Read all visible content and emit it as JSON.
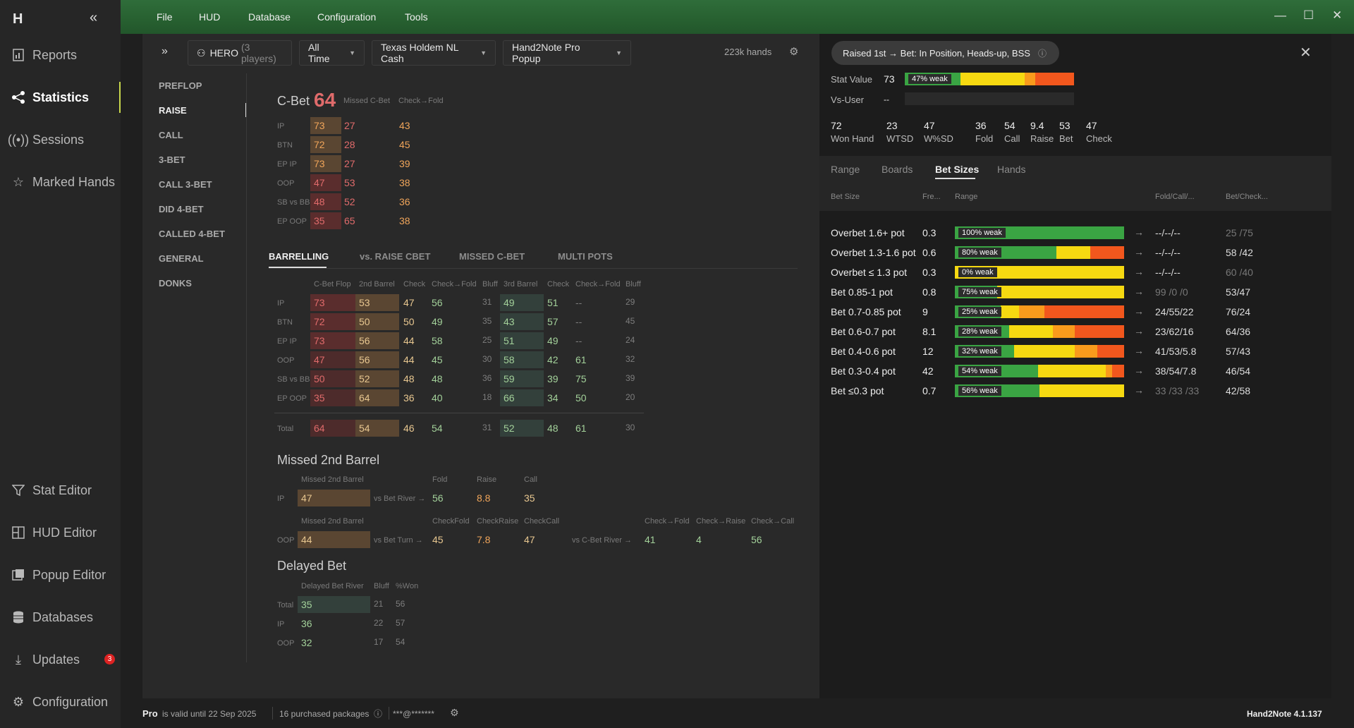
{
  "app": {
    "logo": "H",
    "version": "Hand2Note 4.1.137"
  },
  "nav": {
    "items": [
      {
        "label": "Reports",
        "icon": "report-icon"
      },
      {
        "label": "Statistics",
        "icon": "share-nodes-icon",
        "active": true
      },
      {
        "label": "Sessions",
        "icon": "broadcast-icon"
      },
      {
        "label": "Marked Hands",
        "icon": "star-icon"
      }
    ],
    "bottom": [
      {
        "label": "Stat Editor",
        "icon": "filter-icon"
      },
      {
        "label": "HUD Editor",
        "icon": "grid-icon"
      },
      {
        "label": "Popup Editor",
        "icon": "popup-icon"
      },
      {
        "label": "Databases",
        "icon": "database-icon"
      },
      {
        "label": "Updates",
        "icon": "download-icon",
        "badge": "3"
      },
      {
        "label": "Configuration",
        "icon": "gear-icon"
      }
    ]
  },
  "menu": [
    "File",
    "HUD",
    "Database",
    "Configuration",
    "Tools"
  ],
  "toolbar": {
    "player": "HERO",
    "player_sub": "(3 players)",
    "time": "All Time",
    "game": "Texas Holdem NL Cash",
    "popup": "Hand2Note Pro Popup",
    "hands": "223k hands"
  },
  "categories": [
    "PREFLOP",
    "RAISE",
    "CALL",
    "3-BET",
    "CALL 3-BET",
    "DID 4-BET",
    "CALLED 4-BET",
    "GENERAL",
    "DONKS"
  ],
  "cbet": {
    "title": "C-Bet",
    "value": "64",
    "h_missed": "Missed C-Bet",
    "h_checkfold": "Check→Fold",
    "rows": [
      {
        "pos": "IP",
        "v": "73",
        "m": "27",
        "cf": "43"
      },
      {
        "pos": "BTN",
        "v": "72",
        "m": "28",
        "cf": "45"
      },
      {
        "pos": "EP IP",
        "v": "73",
        "m": "27",
        "cf": "39"
      },
      {
        "pos": "OOP",
        "v": "47",
        "m": "53",
        "cf": "38"
      },
      {
        "pos": "SB vs BB",
        "v": "48",
        "m": "52",
        "cf": "36"
      },
      {
        "pos": "EP OOP",
        "v": "35",
        "m": "65",
        "cf": "38"
      }
    ]
  },
  "tabs": [
    "BARRELLING",
    "vs. RAISE CBET",
    "MISSED C-BET",
    "MULTI POTS"
  ],
  "barrel": {
    "headers": [
      "C-Bet Flop",
      "2nd Barrel",
      "Check",
      "Check→Fold",
      "Bluff",
      "3rd Barrel",
      "Check",
      "Check→Fold",
      "Bluff"
    ],
    "rows": [
      {
        "pos": "IP",
        "c": [
          "73",
          "53",
          "47",
          "56",
          "31",
          "49",
          "51",
          "--",
          "29"
        ]
      },
      {
        "pos": "BTN",
        "c": [
          "72",
          "50",
          "50",
          "49",
          "35",
          "43",
          "57",
          "--",
          "45"
        ]
      },
      {
        "pos": "EP IP",
        "c": [
          "73",
          "56",
          "44",
          "58",
          "25",
          "51",
          "49",
          "--",
          "24"
        ]
      },
      {
        "pos": "OOP",
        "c": [
          "47",
          "56",
          "44",
          "45",
          "30",
          "58",
          "42",
          "61",
          "32"
        ]
      },
      {
        "pos": "SB vs BB",
        "c": [
          "50",
          "52",
          "48",
          "48",
          "36",
          "59",
          "39",
          "75",
          "39"
        ]
      },
      {
        "pos": "EP OOP",
        "c": [
          "35",
          "64",
          "36",
          "40",
          "18",
          "66",
          "34",
          "50",
          "20"
        ]
      }
    ],
    "total": {
      "pos": "Total",
      "c": [
        "64",
        "54",
        "46",
        "54",
        "31",
        "52",
        "48",
        "61",
        "30"
      ]
    }
  },
  "missed2": {
    "title": "Missed 2nd Barrel",
    "r1": {
      "h": "Missed 2nd Barrel",
      "pos": "IP",
      "v": "47",
      "vs": "vs Bet River →",
      "hFold": "Fold",
      "hRaise": "Raise",
      "hCall": "Call",
      "fold": "56",
      "raise": "8.8",
      "call": "35"
    },
    "r2": {
      "h": "Missed 2nd Barrel",
      "pos": "OOP",
      "v": "44",
      "vs": "vs Bet Turn →",
      "hCF": "CheckFold",
      "hCR": "CheckRaise",
      "hCC": "CheckCall",
      "cf": "45",
      "cr": "7.8",
      "cc": "47",
      "vs2": "vs C-Bet River →",
      "h2cf": "Check→Fold",
      "h2cr": "Check→Raise",
      "h2cc": "Check→Call",
      "v2cf": "41",
      "v2cr": "4",
      "v2cc": "56"
    }
  },
  "delayed": {
    "title": "Delayed Bet",
    "h": [
      "Delayed Bet River",
      "Bluff",
      "%Won"
    ],
    "rows": [
      {
        "pos": "Total",
        "v": "35",
        "b": "21",
        "w": "56"
      },
      {
        "pos": "IP",
        "v": "36",
        "b": "22",
        "w": "57"
      },
      {
        "pos": "OOP",
        "v": "32",
        "b": "17",
        "w": "54"
      }
    ]
  },
  "right": {
    "pill": "Raised 1st → Bet: In Position, Heads-up, BSS",
    "stat_value_label": "Stat Value",
    "stat_value": "73",
    "stat_weak": "47% weak",
    "vs_user_label": "Vs-User",
    "vs_user": "--",
    "stats": [
      {
        "v": "72",
        "l": "Won Hand"
      },
      {
        "v": "23",
        "l": "WTSD"
      },
      {
        "v": "47",
        "l": "W%SD"
      },
      {
        "v": "36",
        "l": "Fold"
      },
      {
        "v": "54",
        "l": "Call"
      },
      {
        "v": "9.4",
        "l": "Raise"
      },
      {
        "v": "53",
        "l": "Bet"
      },
      {
        "v": "47",
        "l": "Check"
      }
    ],
    "tabs": [
      "Range",
      "Boards",
      "Bet Sizes",
      "Hands"
    ],
    "cols": [
      "Bet Size",
      "Fre...",
      "Range",
      "Fold/Call/...",
      "Bet/Check..."
    ],
    "rows": [
      {
        "label": "Overbet 1.6+ pot",
        "freq": "0.3",
        "weak": "100% weak",
        "fcr": "--/--/--",
        "bc": "25 /75",
        "bc_dim": true,
        "bar": [
          100,
          0,
          0,
          0
        ]
      },
      {
        "label": "Overbet 1.3-1.6 pot",
        "freq": "0.6",
        "weak": "80% weak",
        "fcr": "--/--/--",
        "bc": "58 /42",
        "bar": [
          60,
          20,
          0,
          20
        ]
      },
      {
        "label": "Overbet ≤ 1.3 pot",
        "freq": "0.3",
        "weak": "0% weak",
        "fcr": "--/--/--",
        "bc": "60 /40",
        "bc_dim": true,
        "bar": [
          0,
          100,
          0,
          0
        ]
      },
      {
        "label": "Bet 0.85-1 pot",
        "freq": "0.8",
        "weak": "75% weak",
        "fcr": "99 /0 /0",
        "fcr_dim": true,
        "bc": "53/47",
        "bar": [
          25,
          75,
          0,
          0
        ]
      },
      {
        "label": "Bet 0.7-0.85 pot",
        "freq": "9",
        "weak": "25% weak",
        "fcr": "24/55/22",
        "bc": "76/24",
        "bar": [
          27,
          11,
          15,
          47
        ]
      },
      {
        "label": "Bet 0.6-0.7 pot",
        "freq": "8.1",
        "weak": "28% weak",
        "fcr": "23/62/16",
        "bc": "64/36",
        "bar": [
          32,
          26,
          13,
          29
        ]
      },
      {
        "label": "Bet 0.4-0.6 pot",
        "freq": "12",
        "weak": "32% weak",
        "fcr": "41/53/5.8",
        "bc": "57/43",
        "bar": [
          35,
          36,
          13,
          16
        ]
      },
      {
        "label": "Bet 0.3-0.4 pot",
        "freq": "42",
        "weak": "54% weak",
        "fcr": "38/54/7.8",
        "bc": "46/54",
        "bar": [
          49,
          40,
          4,
          7
        ]
      },
      {
        "label": "Bet ≤0.3 pot",
        "freq": "0.7",
        "weak": "56% weak",
        "fcr": "33 /33 /33",
        "fcr_dim": true,
        "bc": "42/58",
        "bar": [
          50,
          50,
          0,
          0
        ]
      }
    ]
  },
  "statusbar": {
    "pro": "Pro",
    "valid": "is valid until 22 Sep 2025",
    "packages": "16 purchased packages",
    "email": "***@*******"
  },
  "colors": {
    "green": "#3aa443",
    "yellow": "#f6d911",
    "orange": "#f99b1c",
    "red": "#f2571d"
  }
}
